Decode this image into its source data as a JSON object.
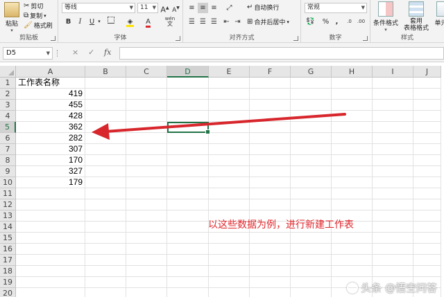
{
  "ribbon": {
    "clipboard": {
      "group_label": "剪贴板",
      "paste_label": "粘贴",
      "cut_label": "剪切",
      "copy_label": "复制",
      "format_painter_label": "格式刷"
    },
    "font": {
      "group_label": "字体",
      "font_name": "等线",
      "font_size": "11",
      "grow_label": "A",
      "shrink_label": "A",
      "bold_label": "B",
      "italic_label": "I",
      "underline_label": "U",
      "font_color_label": "A",
      "phonetic_label": "wén"
    },
    "alignment": {
      "group_label": "对齐方式",
      "wrap_text_label": "自动换行",
      "merge_center_label": "合并后居中"
    },
    "number": {
      "group_label": "数字",
      "format_value": "常规",
      "percent_label": "%",
      "comma_label": ","
    },
    "styles": {
      "group_label": "样式",
      "conditional_label": "条件格式",
      "table_format_label_1": "套用",
      "table_format_label_2": "表格格式",
      "cell_styles_label": "单元格"
    }
  },
  "formula_bar": {
    "name_box": "D5",
    "cancel_icon": "×",
    "enter_icon": "✓",
    "function_icon": "fx",
    "formula": ""
  },
  "sheet": {
    "columns": [
      "A",
      "B",
      "C",
      "D",
      "E",
      "F",
      "G",
      "H",
      "I",
      "J"
    ],
    "selected_column": "D",
    "selected_row": "5",
    "rows": [
      "1",
      "2",
      "3",
      "4",
      "5",
      "6",
      "7",
      "8",
      "9",
      "10",
      "11",
      "12",
      "13",
      "14",
      "15",
      "16",
      "17",
      "18",
      "19",
      "20"
    ],
    "column_a": {
      "header": "工作表名称",
      "values": [
        "419",
        "455",
        "428",
        "362",
        "282",
        "307",
        "170",
        "327",
        "179"
      ]
    }
  },
  "annotation": {
    "text": "以这些数据为例，进行新建工作表",
    "color": "#e0262b"
  },
  "watermark": {
    "text": "头条 @悟空问答"
  },
  "colors": {
    "accent": "#217346",
    "ribbon_bg": "#f3f3f3",
    "header_bg": "#e6e6e6",
    "arrow": "#d7262c"
  }
}
